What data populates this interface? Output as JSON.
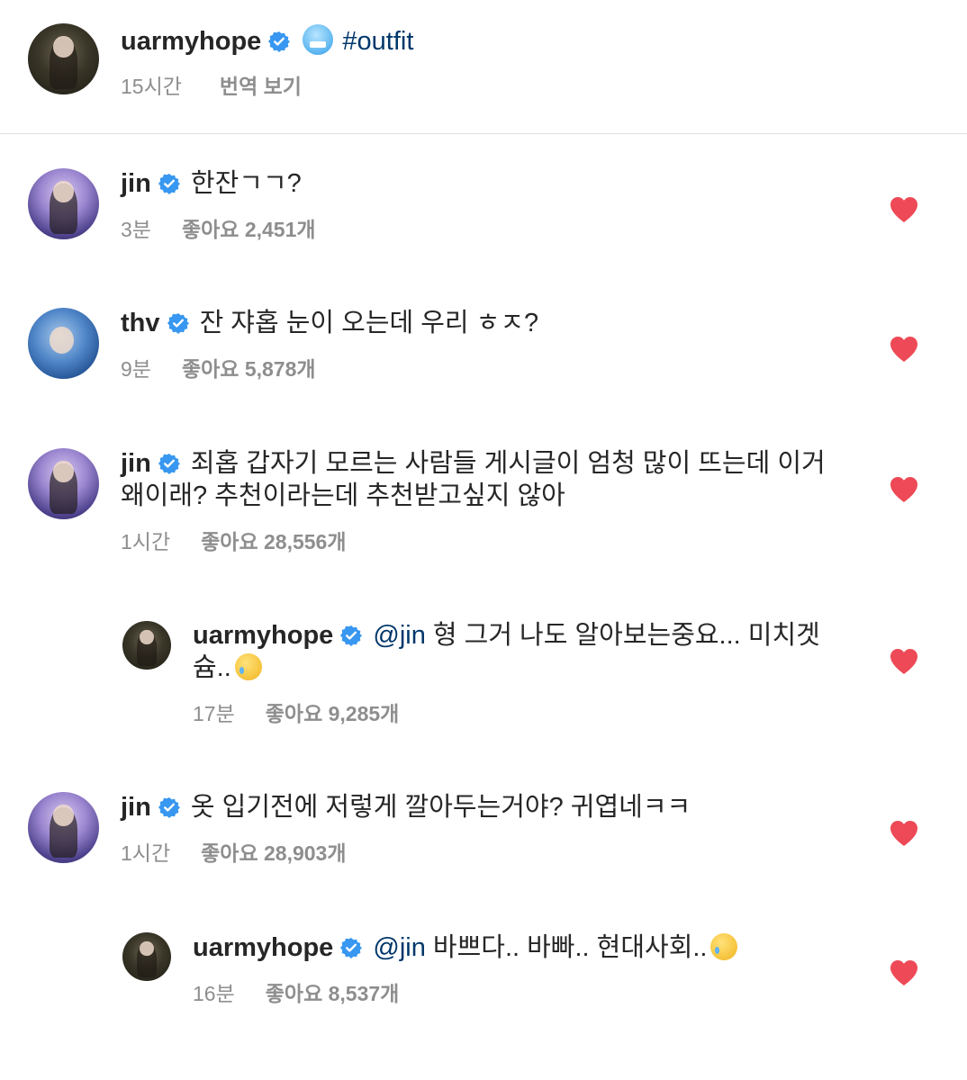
{
  "post": {
    "username": "uarmyhope",
    "caption_tag": "#outfit",
    "caption_emoji": "cold-face-emoji",
    "time": "15시간",
    "translate": "번역 보기"
  },
  "comments": [
    {
      "username": "jin",
      "text": "한잔ㄱㄱ?",
      "time": "3분",
      "likes": "좋아요 2,451개"
    },
    {
      "username": "thv",
      "text": "잔 쟈홉 눈이 오는데 우리 ㅎㅈ?",
      "time": "9분",
      "likes": "좋아요 5,878개"
    },
    {
      "username": "jin",
      "text": "죄홉 갑자기 모르는 사람들 게시글이 엄청 많이 뜨는데 이거",
      "text2": "왜이래? 추천이라는데 추천받고싶지 않아",
      "time": "1시간",
      "likes": "좋아요 28,556개"
    },
    {
      "username": "uarmyhope",
      "mention": "@jin",
      "text": "형 그거 나도 알아보는중요... 미치겟",
      "text2": "슘..",
      "time": "17분",
      "likes": "좋아요 9,285개"
    },
    {
      "username": "jin",
      "text": "옷 입기전에 저렇게 깔아두는거야? 귀엽네ㅋㅋ",
      "time": "1시간",
      "likes": "좋아요 28,903개"
    },
    {
      "username": "uarmyhope",
      "mention": "@jin",
      "text": "바쁘다.. 바빠.. 현대사회..",
      "time": "16분",
      "likes": "좋아요 8,537개"
    }
  ],
  "colors": {
    "heart": "#ed4956",
    "verified": "#3897f0",
    "link": "#00376b",
    "meta": "#8e8e8e"
  }
}
